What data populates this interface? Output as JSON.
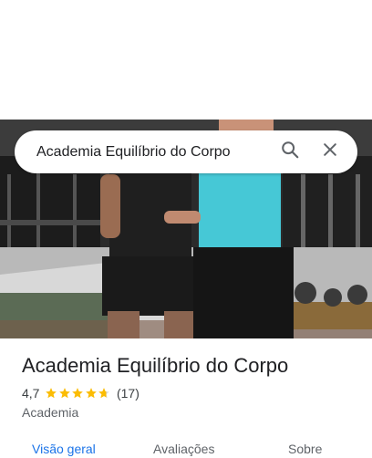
{
  "search": {
    "query": "Academia Equilíbrio do Corpo",
    "search_icon": "search-icon",
    "close_icon": "close-icon"
  },
  "place": {
    "name": "Academia Equilíbrio do Corpo",
    "rating": "4,7",
    "rating_numeric": 4.7,
    "review_count": "(17)",
    "category": "Academia"
  },
  "tabs": [
    {
      "label": "Visão geral",
      "active": true
    },
    {
      "label": "Avaliações",
      "active": false
    },
    {
      "label": "Sobre",
      "active": false
    }
  ],
  "colors": {
    "accent": "#1a73e8",
    "star": "#fbbc04",
    "shirt": "#46c8d6"
  }
}
